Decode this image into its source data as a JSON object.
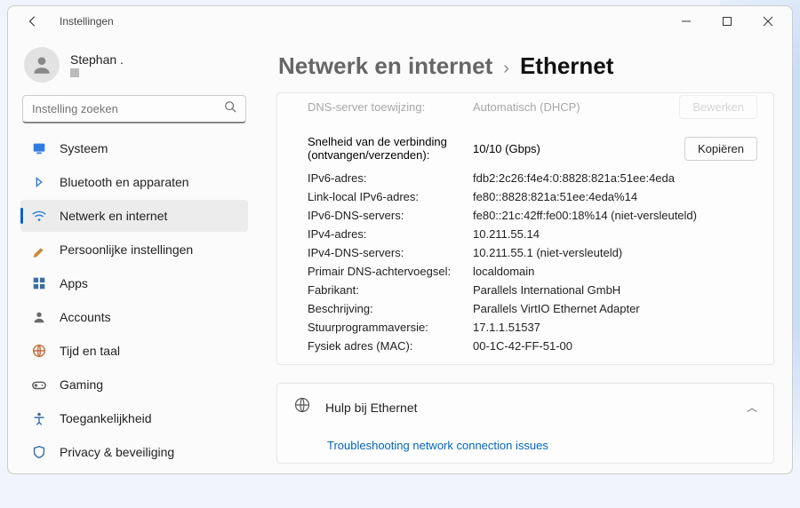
{
  "app_title": "Instellingen",
  "user": {
    "name": "Stephan ."
  },
  "search": {
    "placeholder": "Instelling zoeken"
  },
  "nav": {
    "items": [
      {
        "icon": "display",
        "color": "#2f7de1",
        "label": "Systeem"
      },
      {
        "icon": "bluetooth",
        "color": "#2f7de1",
        "label": "Bluetooth en apparaten"
      },
      {
        "icon": "wifi",
        "color": "#2f7de1",
        "label": "Netwerk en internet",
        "active": true
      },
      {
        "icon": "brush",
        "color": "#c98a3d",
        "label": "Persoonlijke instellingen"
      },
      {
        "icon": "grid",
        "color": "#3a6ea5",
        "label": "Apps"
      },
      {
        "icon": "person",
        "color": "#6a6a6a",
        "label": "Accounts"
      },
      {
        "icon": "globe",
        "color": "#c96a3d",
        "label": "Tijd en taal"
      },
      {
        "icon": "gamepad",
        "color": "#5a5a5a",
        "label": "Gaming"
      },
      {
        "icon": "access",
        "color": "#3a6ea5",
        "label": "Toegankelijkheid"
      },
      {
        "icon": "shield",
        "color": "#3a6ea5",
        "label": "Privacy & beveiliging"
      }
    ]
  },
  "breadcrumb": {
    "parent": "Netwerk en internet",
    "current": "Ethernet"
  },
  "panel": {
    "cut_row": {
      "label": "DNS-server toewijzing:",
      "value": "Automatisch (DHCP)",
      "button": "Bewerken"
    },
    "speed_row": {
      "label": "Snelheid van de verbinding (ontvangen/verzenden):",
      "value": "10/10 (Gbps)",
      "button": "Kopiëren"
    },
    "rows": [
      {
        "label": "IPv6-adres:",
        "value": "fdb2:2c26:f4e4:0:8828:821a:51ee:4eda"
      },
      {
        "label": "Link-local IPv6-adres:",
        "value": "fe80::8828:821a:51ee:4eda%14"
      },
      {
        "label": "IPv6-DNS-servers:",
        "value": "fe80::21c:42ff:fe00:18%14 (niet-versleuteld)"
      },
      {
        "label": "IPv4-adres:",
        "value": "10.211.55.14"
      },
      {
        "label": "IPv4-DNS-servers:",
        "value": "10.211.55.1 (niet-versleuteld)"
      },
      {
        "label": "Primair DNS-achtervoegsel:",
        "value": "localdomain"
      },
      {
        "label": "Fabrikant:",
        "value": "Parallels International GmbH"
      },
      {
        "label": "Beschrijving:",
        "value": "Parallels VirtIO Ethernet Adapter"
      },
      {
        "label": "Stuurprogrammaversie:",
        "value": "17.1.1.51537"
      },
      {
        "label": "Fysiek adres (MAC):",
        "value": "00-1C-42-FF-51-00"
      }
    ]
  },
  "help": {
    "title": "Hulp bij Ethernet",
    "link": "Troubleshooting network connection issues"
  },
  "annotation_arrow_color": "#2fa82f"
}
